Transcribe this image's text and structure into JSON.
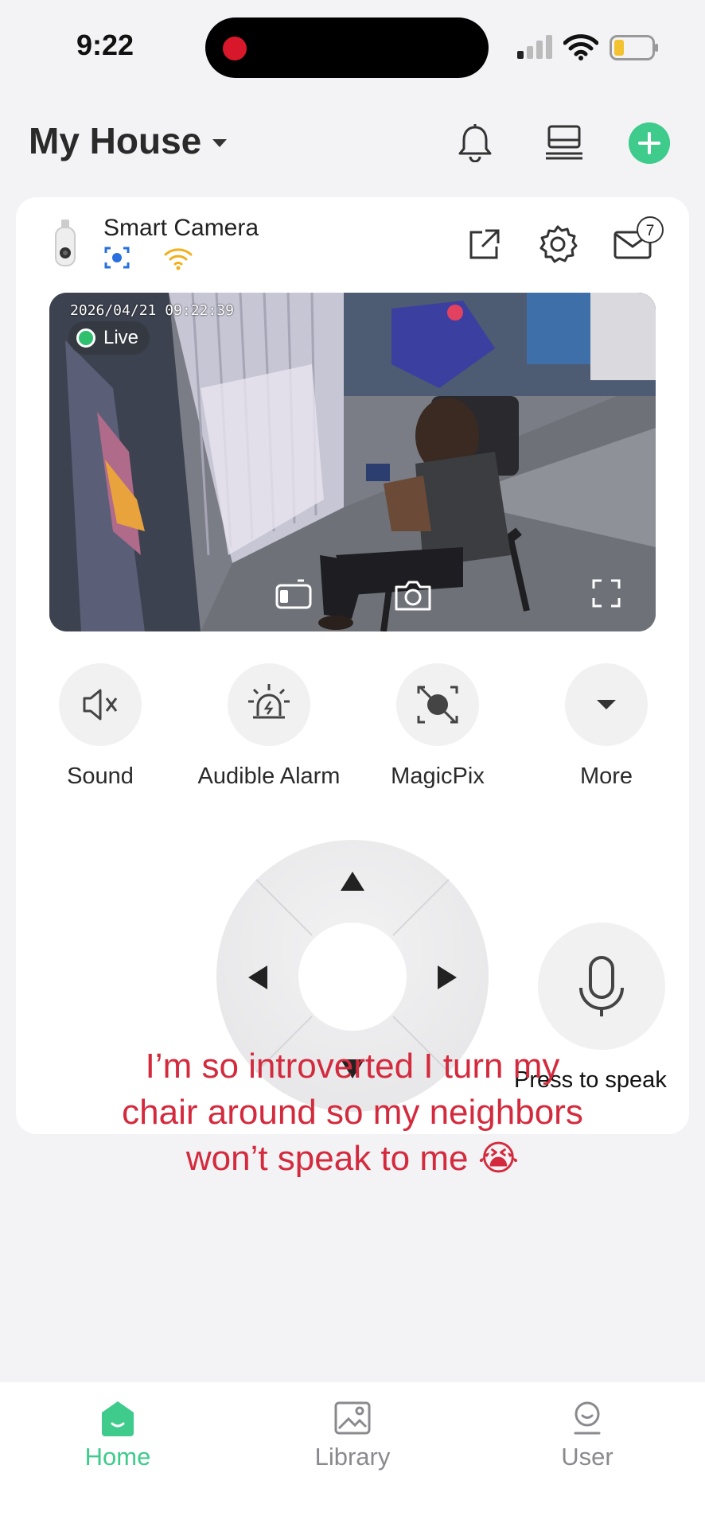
{
  "status_bar": {
    "time": "9:22"
  },
  "header": {
    "title": "My House"
  },
  "camera": {
    "name": "Smart Camera",
    "message_count": "7",
    "timestamp": "2026/04/21 09:22:39",
    "live_label": "Live"
  },
  "controls": [
    {
      "label": "Sound",
      "icon": "sound-muted-icon"
    },
    {
      "label": "Audible Alarm",
      "icon": "alarm-siren-icon"
    },
    {
      "label": "MagicPix",
      "icon": "magicpix-icon"
    },
    {
      "label": "More",
      "icon": "chevron-down-icon"
    }
  ],
  "talk": {
    "label": "Press to speak"
  },
  "caption": {
    "text": "I’m so introverted I turn my chair around so my neighbors won’t speak to me 😭"
  },
  "tabs": [
    {
      "label": "Home",
      "active": true
    },
    {
      "label": "Library",
      "active": false
    },
    {
      "label": "User",
      "active": false
    }
  ],
  "colors": {
    "accent": "#3ecb8b",
    "caption": "#d42a3d",
    "alert": "#d8182a"
  }
}
